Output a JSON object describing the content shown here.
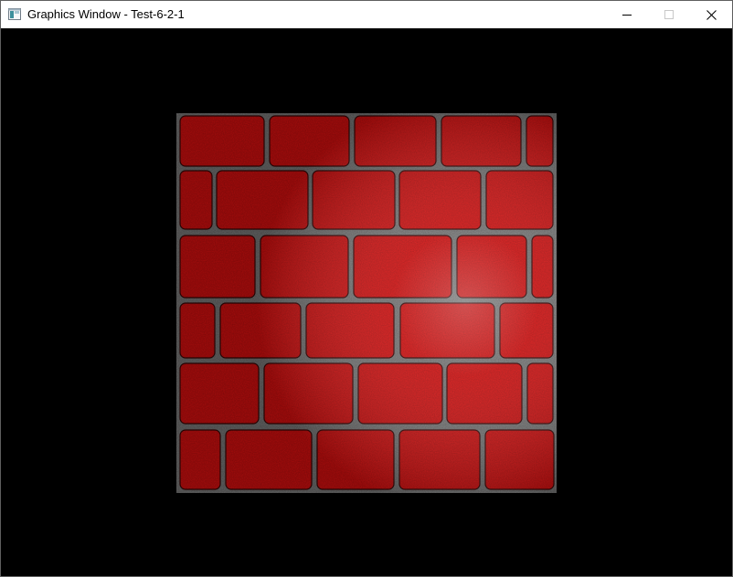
{
  "window": {
    "title": "Graphics Window - Test-6-2-1",
    "icon": "app-window-icon",
    "controls": [
      "minimize-icon",
      "maximize-icon",
      "close-icon"
    ]
  },
  "viewport": {
    "background": "#000000",
    "content": "lit brick-wall texture quad",
    "brick_color": "#dd1010",
    "mortar_color": "#8a8a8a"
  }
}
